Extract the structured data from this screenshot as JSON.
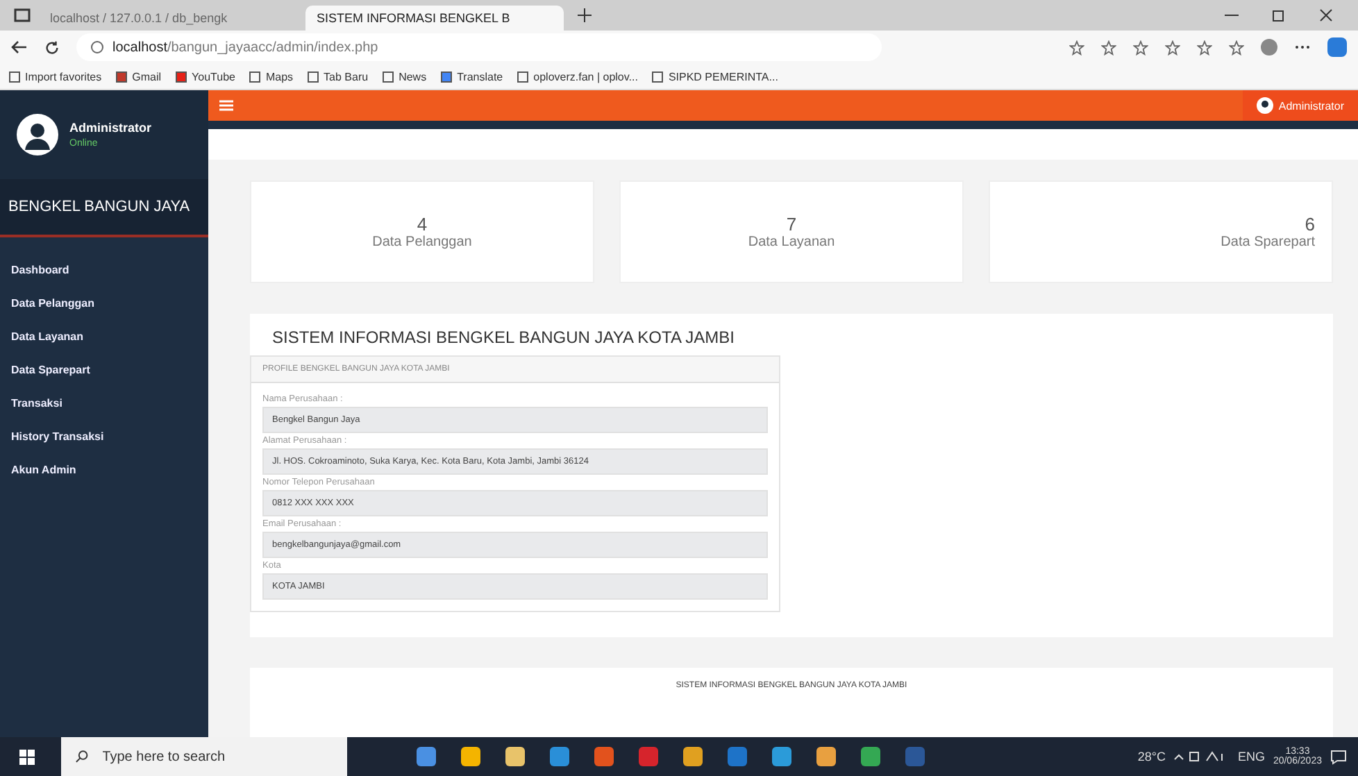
{
  "browser": {
    "tabs": [
      {
        "title": "localhost / 127.0.0.1 / db_bengk",
        "selected": false
      },
      {
        "title": "SISTEM INFORMASI BENGKEL B",
        "selected": true
      }
    ],
    "address": {
      "host": "localhost",
      "path": "/bangun_jayaacc/admin/index.php"
    },
    "bookmarks": [
      "Import favorites",
      "Gmail",
      "YouTube",
      "Maps",
      "Tab Baru",
      "News",
      "Translate",
      "oploverz.fan | oplov...",
      "SIPKD PEMERINTA..."
    ]
  },
  "sidebar": {
    "user": {
      "name": "Administrator",
      "status": "Online"
    },
    "brand": "BENGKEL BANGUN JAYA",
    "items": [
      {
        "label": "Dashboard"
      },
      {
        "label": "Data Pelanggan"
      },
      {
        "label": "Data Layanan"
      },
      {
        "label": "Data Sparepart"
      },
      {
        "label": "Transaksi"
      },
      {
        "label": "History Transaksi"
      },
      {
        "label": "Akun Admin"
      }
    ]
  },
  "header": {
    "user_menu": "Administrator"
  },
  "stats": [
    {
      "value": "4",
      "label": "Data Pelanggan"
    },
    {
      "value": "7",
      "label": "Data Layanan"
    },
    {
      "value": "6",
      "label": "Data Sparepart"
    }
  ],
  "panel": {
    "title": "SISTEM INFORMASI BENGKEL BANGUN JAYA KOTA JAMBI",
    "profile_title": "PROFILE BENGKEL BANGUN JAYA KOTA JAMBI",
    "fields": [
      {
        "label": "Nama Perusahaan :",
        "value": "Bengkel Bangun Jaya"
      },
      {
        "label": "Alamat Perusahaan :",
        "value": "Jl. HOS. Cokroaminoto, Suka Karya, Kec. Kota Baru, Kota Jambi, Jambi 36124"
      },
      {
        "label": "Nomor Telepon Perusahaan",
        "value": "0812 XXX XXX XXX"
      },
      {
        "label": "Email Perusahaan :",
        "value": "bengkelbangunjaya@gmail.com"
      },
      {
        "label": "Kota",
        "value": "KOTA JAMBI"
      }
    ]
  },
  "footer": "SISTEM INFORMASI BENGKEL BANGUN JAYA KOTA JAMBI",
  "taskbar": {
    "search_placeholder": "Type here to search",
    "weather": "28°C",
    "language": "ENG",
    "time": "13:33",
    "date": "20/06/2023"
  }
}
